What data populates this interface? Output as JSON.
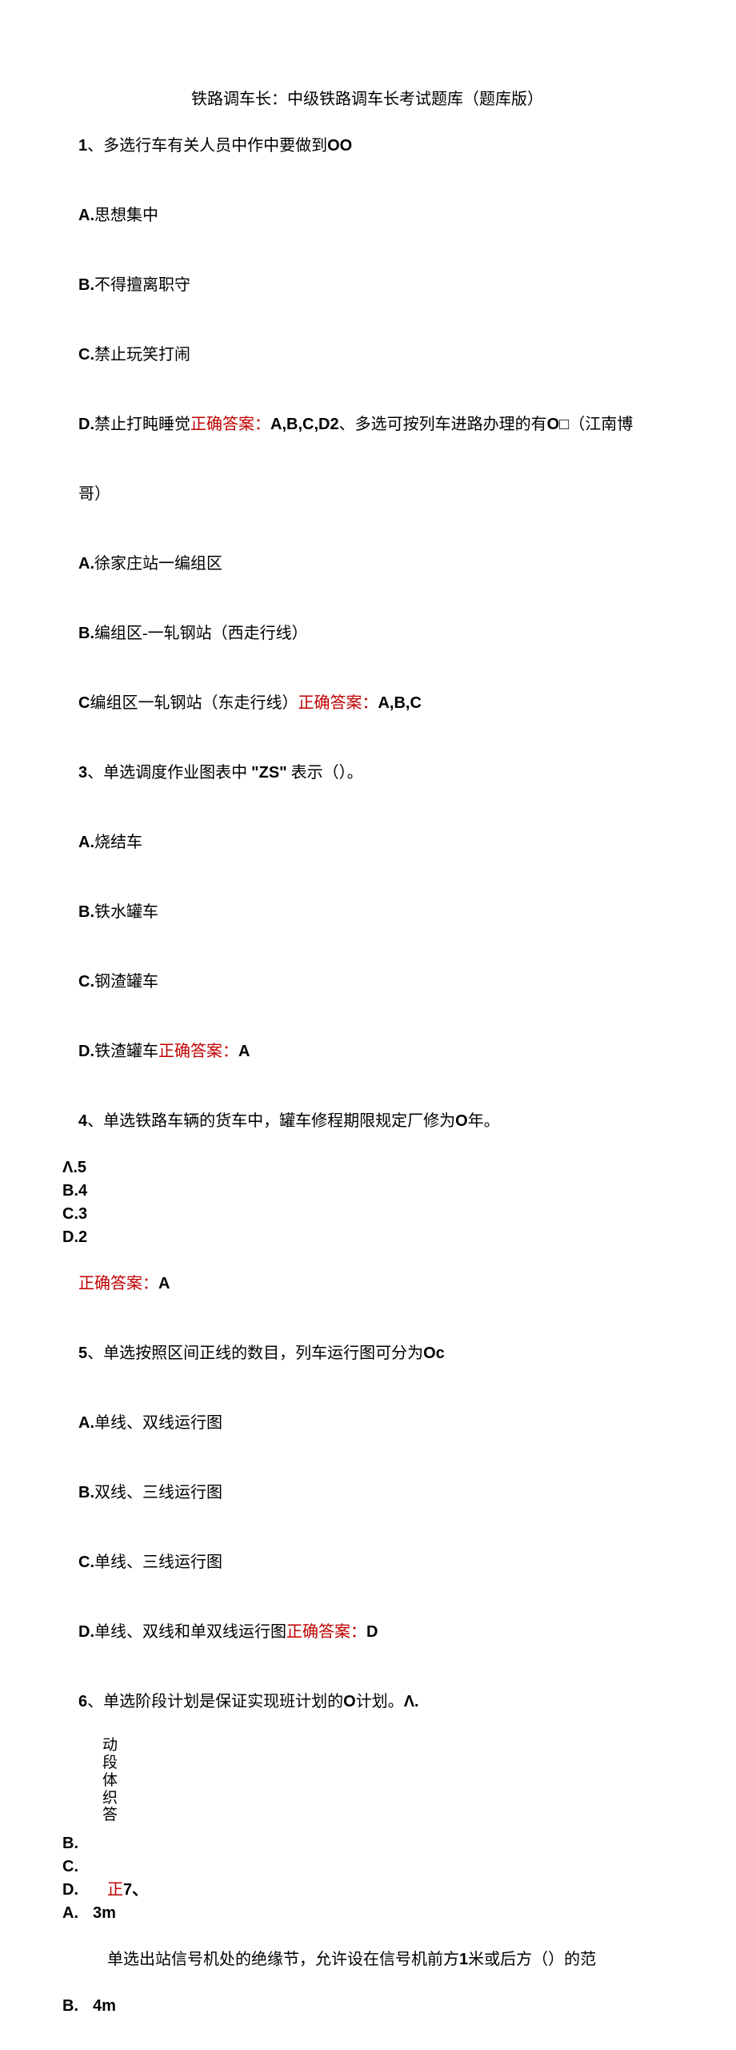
{
  "title": "铁路调车长：中级铁路调车长考试题库（题库版）",
  "q1": {
    "stem_prefix": "1",
    "stem": "、多选行车有关人员中作中要做到",
    "stem_suffix": "OO",
    "a_prefix": "A.",
    "a": "思想集中",
    "b_prefix": "B.",
    "b": "不得擅离职守",
    "c_prefix": "C.",
    "c": "禁止玩笑打闹",
    "d_prefix": "D.",
    "d": "禁止打盹睡觉",
    "ans_label": "正确答案：",
    "ans_value": "A,B,C,D"
  },
  "q2": {
    "stem_prefix": "2",
    "stem_a": "、多选可按列车进路办理的有",
    "stem_b": "O",
    "stem_c": "□（江南博",
    "stem_d": "哥）",
    "a_prefix": "A.",
    "a": "徐家庄站一编组区",
    "b_prefix": "B.",
    "b": "编组区-一轧钢站（西走行线）",
    "c_prefix": "C",
    "c": "编组区一轧钢站（东走行线）",
    "ans_label": "正确答案：",
    "ans_value": "A,B,C"
  },
  "q3": {
    "stem_prefix": "3",
    "stem_a": "、单选调度作业图表中",
    "stem_quote_l": "\"",
    "stem_zs": "ZS",
    "stem_quote_r": "\"",
    "stem_b": "表示（）。",
    "a_prefix": "A.",
    "a": "烧结车",
    "b_prefix": "B.",
    "b": "铁水罐车",
    "c_prefix": "C.",
    "c": "钢渣罐车",
    "d_prefix": "D.",
    "d": "铁渣罐车",
    "ans_label": "正确答案：",
    "ans_value": "A"
  },
  "q4": {
    "stem_prefix": "4",
    "stem_a": "、单选铁路车辆的货车中，罐车修程期限规定厂修为",
    "stem_b": "O",
    "stem_c": "年。",
    "a_prefix": "Λ.5",
    "b_prefix": "B.4",
    "c_prefix": "C.3",
    "d_prefix": "D.2",
    "ans_label": "正确答案：",
    "ans_value": "A"
  },
  "q5": {
    "stem_prefix": "5",
    "stem_a": "、单选按照区间正线的数目，列车运行图可分为",
    "stem_b": "Oc",
    "a_prefix": "A.",
    "a": "单线、双线运行图",
    "b_prefix": "B.",
    "b": "双线、三线运行图",
    "c_prefix": "C.",
    "c": "单线、三线运行图",
    "d_prefix": "D.",
    "d": "单线、双线和单双线运行图",
    "ans_label": "正确答案：",
    "ans_value": "D"
  },
  "q6": {
    "stem_prefix": "6",
    "stem_a": "、单选阶段计划是保证实现班计划的",
    "stem_b": "O",
    "stem_c": "计划。",
    "stem_d": "Λ.",
    "v1": "动",
    "v2": "段",
    "v3": "体",
    "v4": "织",
    "v5": "答",
    "b_prefix": "B.",
    "c_prefix": "C.",
    "d_prefix": "D.",
    "d_red": "正",
    "d_next": "7、"
  },
  "q7": {
    "a_prefix": "A.",
    "a_val": "3m",
    "mid": "单选出站信号机处的绝缘节，允许设在信号机前方",
    "mid_bold": "1",
    "mid2": "米或后方（）的范",
    "b_prefix": "B.",
    "b_val": "4m"
  }
}
